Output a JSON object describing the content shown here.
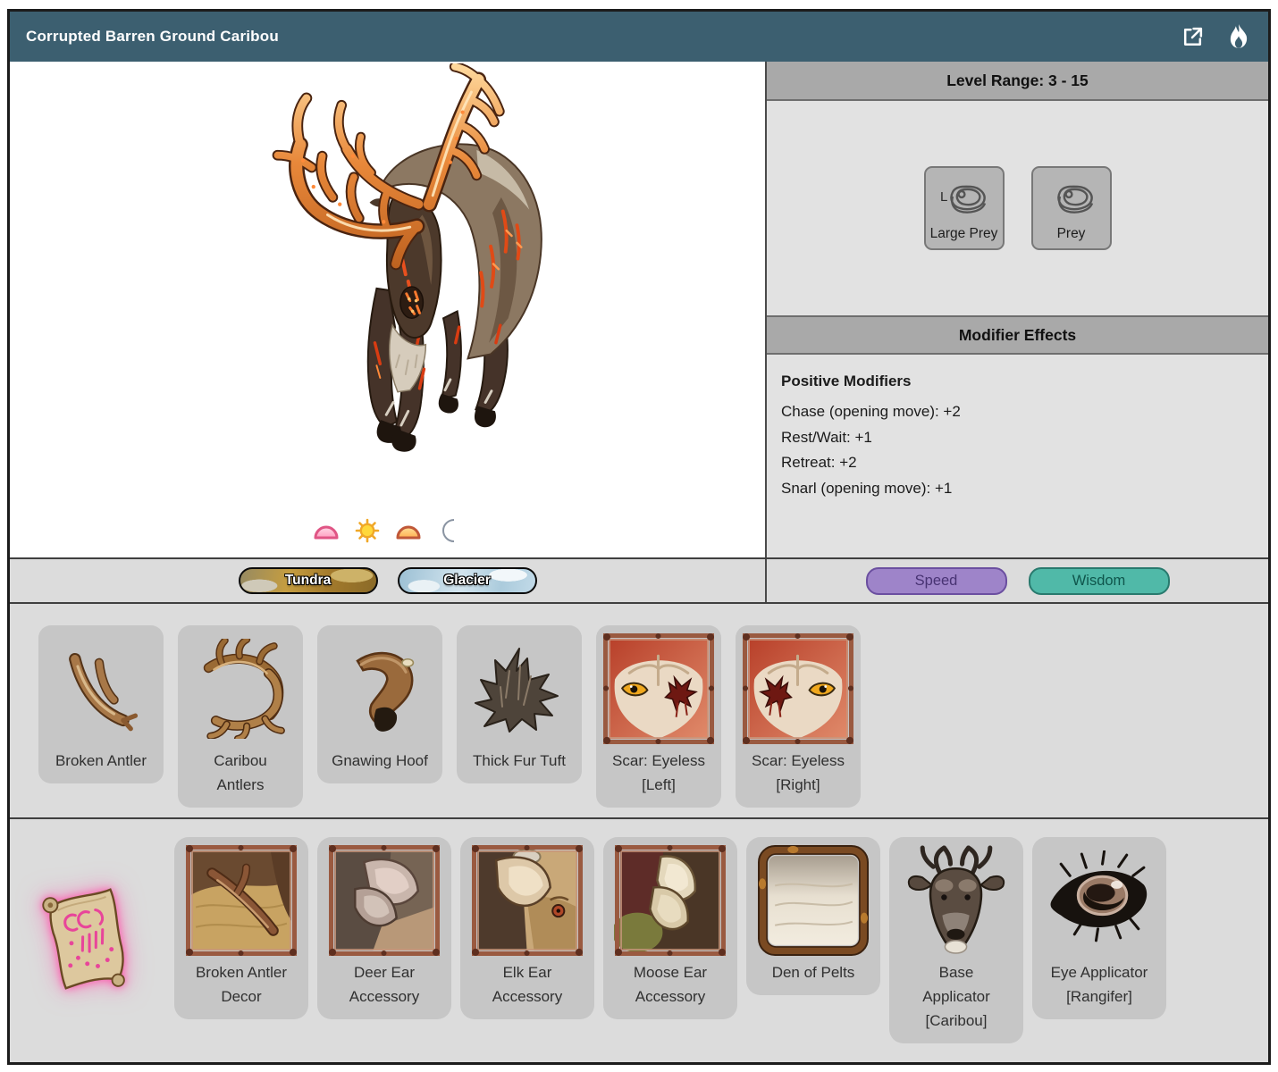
{
  "header": {
    "title": "Corrupted Barren Ground Caribou",
    "actions": [
      {
        "icon": "open-in-new-icon"
      },
      {
        "icon": "flame-icon"
      }
    ],
    "bar_color": "#3c5f70"
  },
  "creature": {
    "art": "corrupted-caribou-art",
    "active_times": [
      {
        "icon": "dawn-icon"
      },
      {
        "icon": "day-icon"
      },
      {
        "icon": "dusk-icon"
      },
      {
        "icon": "night-icon"
      }
    ],
    "biomes": [
      {
        "label": "Tundra"
      },
      {
        "label": "Glacier"
      }
    ]
  },
  "info": {
    "level_range_header": "Level Range: 3 - 15",
    "prey_types": [
      {
        "label": "Large Prey",
        "icon": "large-steak-icon",
        "badge": "L"
      },
      {
        "label": "Prey",
        "icon": "steak-icon",
        "badge": ""
      }
    ],
    "modifier_header": "Modifier Effects",
    "positive_modifiers_title": "Positive Modifiers",
    "positive_modifiers": [
      "Chase (opening move): +2",
      "Rest/Wait: +1",
      "Retreat: +2",
      "Snarl (opening move): +1"
    ],
    "stats": [
      {
        "label": "Speed",
        "color": "#9e84c9"
      },
      {
        "label": "Wisdom",
        "color": "#50b9a8"
      }
    ]
  },
  "drops": [
    {
      "label": "Broken Antler",
      "icon": "broken-antler-art"
    },
    {
      "label": "Caribou\nAntlers",
      "icon": "caribou-antlers-art"
    },
    {
      "label": "Gnawing Hoof",
      "icon": "gnawing-hoof-art"
    },
    {
      "label": "Thick Fur Tuft",
      "icon": "thick-fur-tuft-art"
    },
    {
      "label": "Scar: Eyeless\n[Left]",
      "icon": "scar-eyeless-left-art"
    },
    {
      "label": "Scar: Eyeless\n[Right]",
      "icon": "scar-eyeless-right-art"
    }
  ],
  "customizations": {
    "scroll_icon": "recipe-scroll-icon",
    "items": [
      {
        "label": "Broken Antler\nDecor",
        "icon": "broken-antler-decor-art"
      },
      {
        "label": "Deer Ear\nAccessory",
        "icon": "deer-ear-accessory-art"
      },
      {
        "label": "Elk Ear\nAccessory",
        "icon": "elk-ear-accessory-art"
      },
      {
        "label": "Moose Ear\nAccessory",
        "icon": "moose-ear-accessory-art"
      },
      {
        "label": "Den of Pelts",
        "icon": "den-of-pelts-art"
      },
      {
        "label": "Base\nApplicator\n[Caribou]",
        "icon": "base-applicator-caribou-art"
      },
      {
        "label": "Eye Applicator\n[Rangifer]",
        "icon": "eye-applicator-rangifer-art"
      }
    ]
  }
}
